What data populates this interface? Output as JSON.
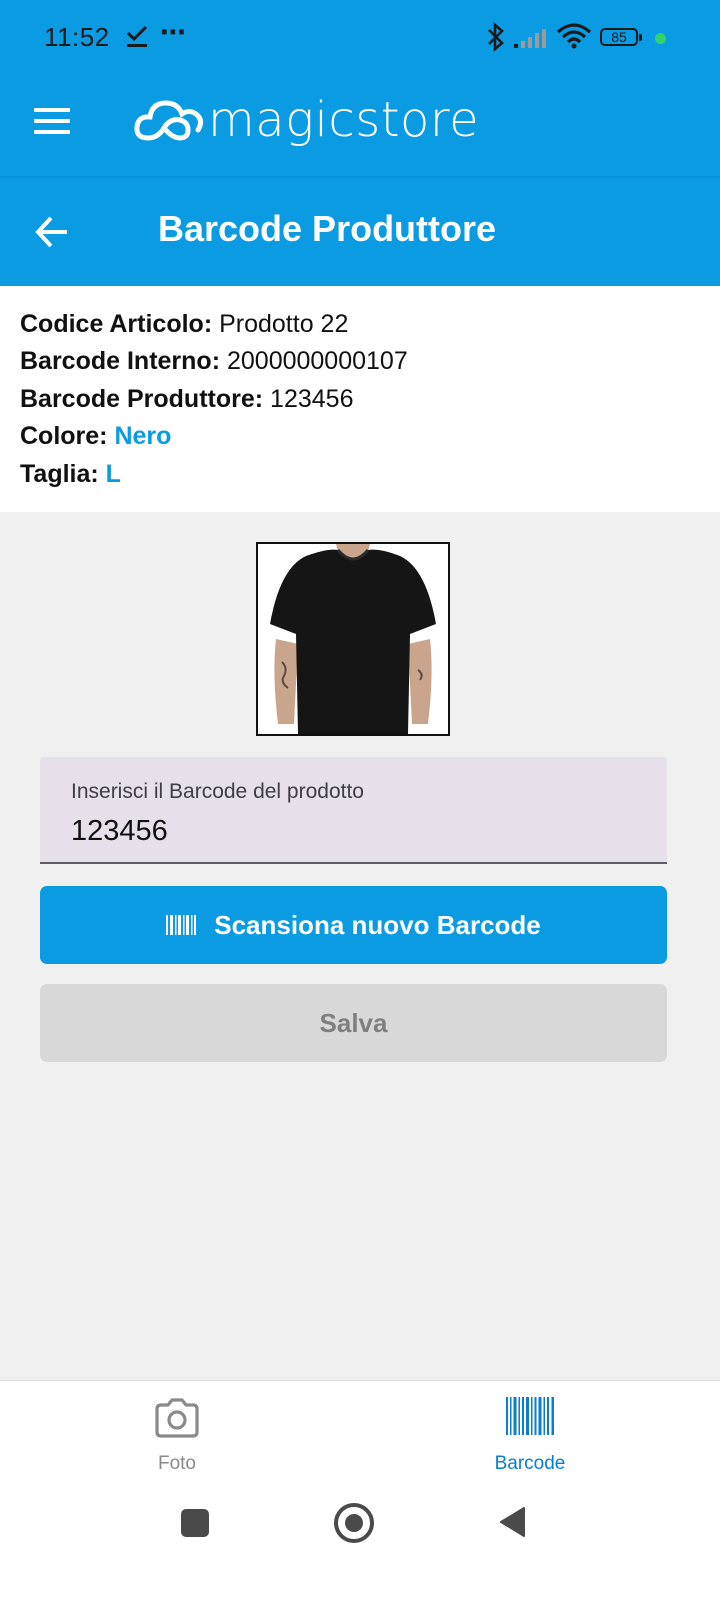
{
  "status": {
    "time": "11:52",
    "battery": "85",
    "overflow": "⋯"
  },
  "header": {
    "logo_text": "magicstore"
  },
  "titlebar": {
    "title": "Barcode Produttore"
  },
  "info": {
    "article_label": "Codice Articolo:",
    "article_value": "Prodotto 22",
    "internal_label": "Barcode Interno:",
    "internal_value": "2000000000107",
    "producer_label": "Barcode Produttore:",
    "producer_value": "123456",
    "color_label": "Colore:",
    "color_value": "Nero",
    "size_label": "Taglia:",
    "size_value": "L"
  },
  "form": {
    "barcode_label": "Inserisci il Barcode del prodotto",
    "barcode_value": "123456",
    "scan_button": "Scansiona nuovo Barcode",
    "save_button": "Salva"
  },
  "bottom_nav": {
    "items": [
      {
        "label": "Foto",
        "icon": "camera-icon",
        "active": false
      },
      {
        "label": "Barcode",
        "icon": "barcode-icon",
        "active": true
      }
    ]
  },
  "colors": {
    "primary": "#0a9be3",
    "field_bg": "#e7dfea",
    "save_disabled": "#d8d8d8",
    "active_nav": "#0a7ecb"
  }
}
